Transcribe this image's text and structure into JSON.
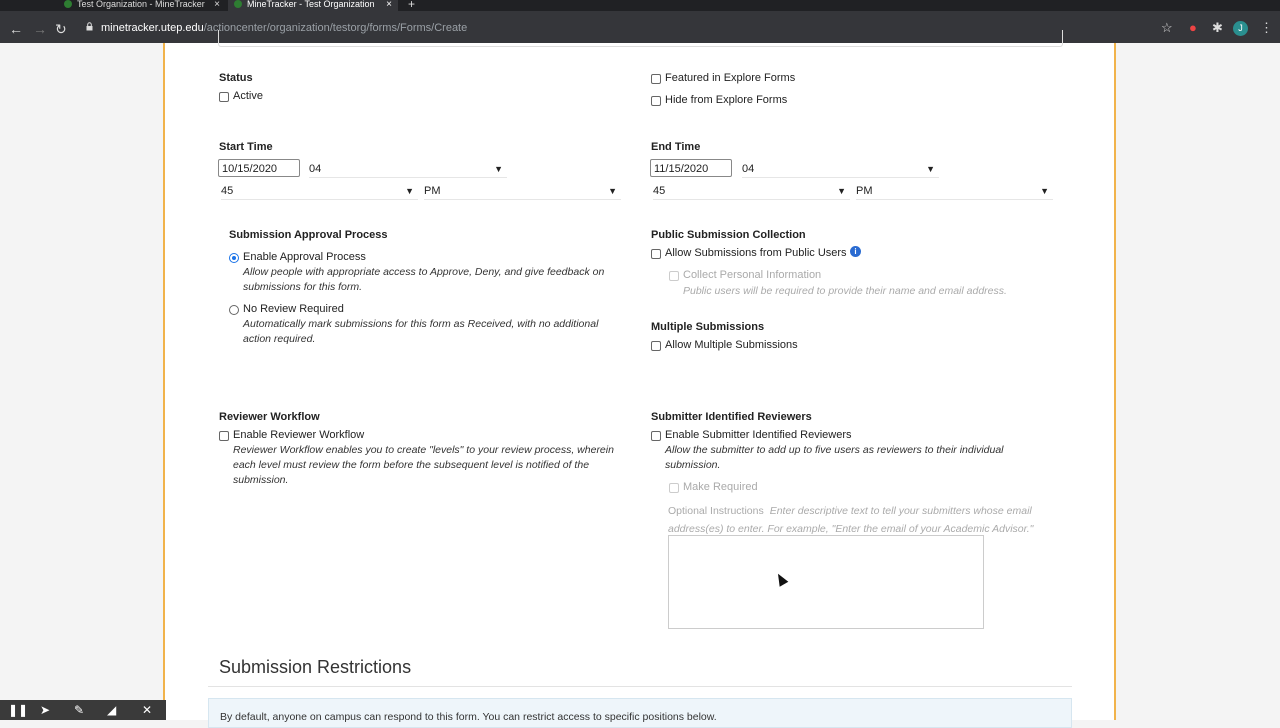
{
  "browser": {
    "tabs": [
      {
        "title": "Test Organization - MineTracker"
      },
      {
        "title": "MineTracker - Test Organization"
      }
    ],
    "new_tab": "+",
    "url_host": "minetracker.utep.edu",
    "url_path": "/actioncenter/organization/testorg/forms/Forms/Create",
    "avatar_letter": "J"
  },
  "status": {
    "label": "Status",
    "active_label": "Active",
    "featured_label": "Featured in Explore Forms",
    "hide_label": "Hide from Explore Forms"
  },
  "start_time": {
    "label": "Start Time",
    "date": "10/15/2020",
    "hour": "04",
    "minute": "45",
    "ampm": "PM"
  },
  "end_time": {
    "label": "End Time",
    "date": "11/15/2020",
    "hour": "04",
    "minute": "45",
    "ampm": "PM"
  },
  "approval": {
    "label": "Submission Approval Process",
    "enable_label": "Enable Approval Process",
    "enable_help": "Allow people with appropriate access to Approve, Deny, and give feedback on submissions for this form.",
    "none_label": "No Review Required",
    "none_help": "Automatically mark submissions for this form as Received, with no additional action required."
  },
  "public": {
    "label": "Public Submission Collection",
    "allow_label": "Allow Submissions from Public Users",
    "collect_label": "Collect Personal Information",
    "collect_help": "Public users will be required to provide their name and email address."
  },
  "multiple": {
    "label": "Multiple Submissions",
    "allow_label": "Allow Multiple Submissions"
  },
  "reviewer": {
    "label": "Reviewer Workflow",
    "enable_label": "Enable Reviewer Workflow",
    "help": "Reviewer Workflow enables you to create \"levels\" to your review process, wherein each level must review the form before the subsequent level is notified of the submission."
  },
  "submitter": {
    "label": "Submitter Identified Reviewers",
    "enable_label": "Enable Submitter Identified Reviewers",
    "help": "Allow the submitter to add up to five users as reviewers to their individual submission.",
    "required_label": "Make Required",
    "instructions_label": "Optional Instructions",
    "instructions_placeholder": "Enter descriptive text to tell your submitters whose email address(es) to enter. For example, \"Enter the email of your Academic Advisor.\""
  },
  "restrictions": {
    "heading": "Submission Restrictions",
    "banner": "By default, anyone on campus can respond to this form. You can restrict access to specific positions below."
  }
}
